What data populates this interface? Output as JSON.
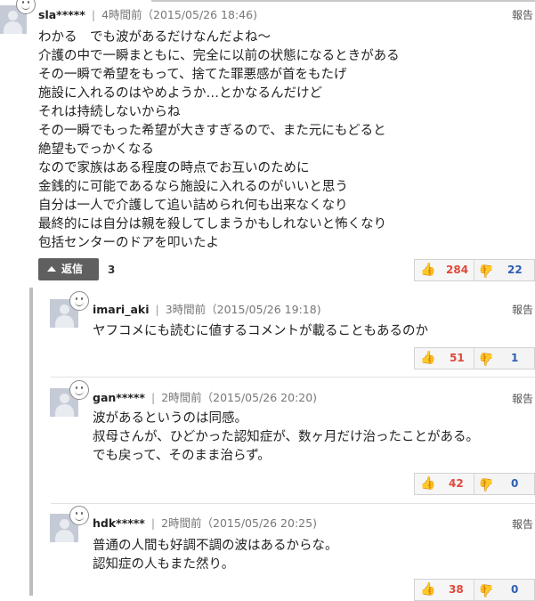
{
  "comments": [
    {
      "user": "sla*****",
      "time": "4時間前（2015/05/26 18:46)",
      "report": "報告",
      "lines": [
        "わかる　でも波があるだけなんだよね～",
        "介護の中で一瞬まともに、完全に以前の状態になるときがある",
        "その一瞬で希望をもって、捨てた罪悪感が首をもたげ",
        "施設に入れるのはやめようか…とかなるんだけど",
        "それは持続しないからね",
        "その一瞬でもった希望が大きすぎるので、また元にもどると",
        "絶望もでっかくなる",
        "なので家族はある程度の時点でお互いのために",
        "金銭的に可能であるなら施設に入れるのがいいと思う",
        "自分は一人で介護して追い詰められ何も出来なくなり",
        "最終的には自分は親を殺してしまうかもしれないと怖くなり",
        "包括センターのドアを叩いたよ"
      ],
      "reply_label": "返信",
      "reply_count": "3",
      "likes": "284",
      "dislikes": "22"
    },
    {
      "user": "imari_aki",
      "time": "3時間前（2015/05/26 19:18)",
      "report": "報告",
      "lines": [
        "ヤフコメにも読むに値するコメントが載ることもあるのか"
      ],
      "likes": "51",
      "dislikes": "1"
    },
    {
      "user": "gan*****",
      "time": "2時間前（2015/05/26 20:20)",
      "report": "報告",
      "lines": [
        "波があるというのは同感。",
        "叔母さんが、ひどかった認知症が、数ヶ月だけ治ったことがある。",
        "でも戻って、そのまま治らず。"
      ],
      "likes": "42",
      "dislikes": "0"
    },
    {
      "user": "hdk*****",
      "time": "2時間前（2015/05/26 20:25)",
      "report": "報告",
      "lines": [
        "普通の人間も好調不調の波はあるからな。",
        "認知症の人もまた然り。"
      ],
      "likes": "38",
      "dislikes": "0"
    }
  ],
  "icons": {
    "like": "thumbs-up-icon",
    "dislike": "thumbs-down-icon",
    "avatar": "default-avatar-icon"
  },
  "colors": {
    "like_count": "#e0493b",
    "dislike_count": "#2d5fb3",
    "reply_button": "#5f5f5f"
  }
}
